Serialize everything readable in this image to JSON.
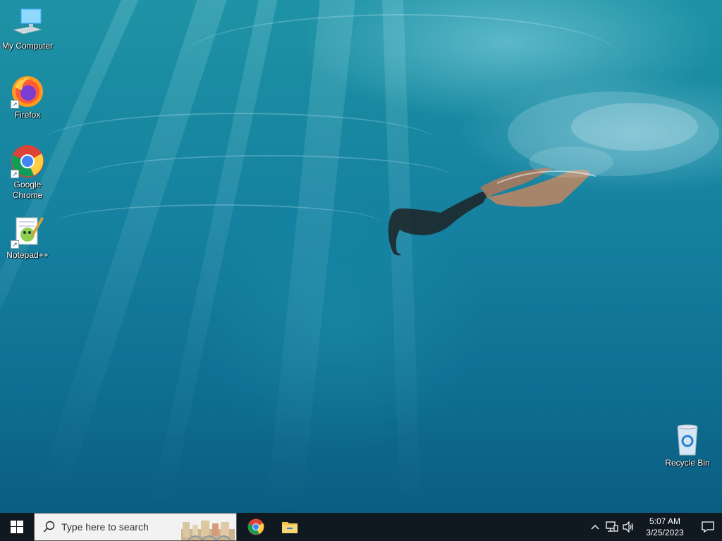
{
  "desktop": {
    "icons": [
      {
        "label": "My Computer",
        "icon": "computer-icon"
      },
      {
        "label": "Firefox",
        "icon": "firefox-icon"
      },
      {
        "label": "Google Chrome",
        "icon": "chrome-icon"
      },
      {
        "label": "Notepad++",
        "icon": "notepadpp-icon"
      },
      {
        "label": "Recycle Bin",
        "icon": "recycle-bin-icon"
      }
    ]
  },
  "taskbar": {
    "search_placeholder": "Type here to search",
    "pinned": [
      {
        "name": "Google Chrome",
        "icon": "chrome-icon"
      },
      {
        "name": "File Explorer",
        "icon": "folder-icon"
      }
    ],
    "clock": {
      "time": "5:07 AM",
      "date": "3/25/2023"
    }
  },
  "colors": {
    "taskbar_bg": "#101820",
    "search_bg": "#f2f2f2",
    "windows_accent": "#ffffff"
  }
}
